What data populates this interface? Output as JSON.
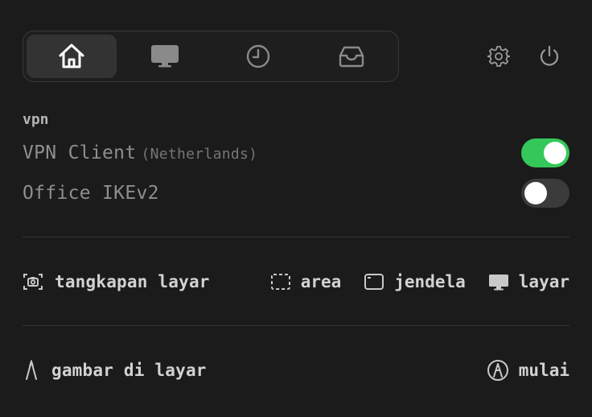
{
  "tabs": [
    {
      "name": "home",
      "icon": "home-icon",
      "active": true
    },
    {
      "name": "display",
      "icon": "monitor-icon",
      "active": false
    },
    {
      "name": "history",
      "icon": "clock-icon",
      "active": false
    },
    {
      "name": "inbox",
      "icon": "inbox-icon",
      "active": false
    }
  ],
  "header_icons": {
    "settings": "gear-icon",
    "power": "power-icon"
  },
  "vpn": {
    "section_title": "vpn",
    "items": [
      {
        "label": "VPN Client",
        "location": "(Netherlands)",
        "enabled": true
      },
      {
        "label": "Office IKEv2",
        "location": "",
        "enabled": false
      }
    ]
  },
  "screenshot": {
    "label": "tangkapan layar",
    "options": [
      "area",
      "jendela",
      "layar"
    ]
  },
  "draw": {
    "label": "gambar di layar",
    "start_label": "mulai"
  },
  "colors": {
    "background": "#1b1b1b",
    "toggle_on": "#34c759",
    "toggle_off": "#3b3b3b"
  }
}
